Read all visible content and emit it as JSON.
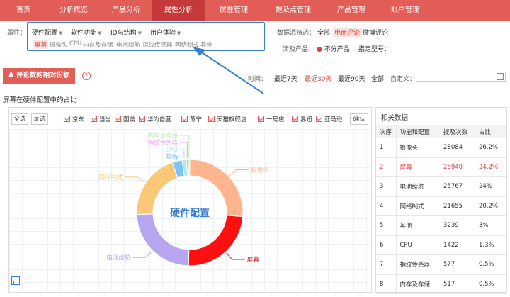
{
  "nav": {
    "items": [
      "首页",
      "分析概览",
      "产品分析",
      "属性分析",
      "属性管理",
      "提及点管理",
      "产品管理",
      "账户管理"
    ],
    "active": 3
  },
  "filter": {
    "attr_label": "属性：",
    "dropdowns": [
      "硬件配置",
      "软件功能",
      "ID与结构",
      "用户体验"
    ],
    "chips": [
      "屏幕",
      "摄像头",
      "CPU",
      "内存及存储",
      "电池续航",
      "指纹传感器",
      "网络制式",
      "其他"
    ],
    "selected_chip": 0,
    "source_label": "数据源筛选：",
    "sources": [
      "全部",
      "电商评论",
      "微博评论"
    ],
    "selected_source": 1,
    "product_label": "涉及产品：",
    "product_radio": "不分产品",
    "model_label": "指定型号："
  },
  "section": {
    "tab_label": "A 评论数的相对份额",
    "help": "?",
    "time_label": "时间：",
    "time_options": [
      "最近7天",
      "最近30天",
      "最近90天",
      "全部"
    ],
    "selected_time": 1,
    "custom_label": "自定义：",
    "chart_title": "屏幕在硬件配置中的占比"
  },
  "controls": {
    "select_all": "全选",
    "invert": "反选",
    "stores": [
      "京东",
      "当当",
      "国美",
      "华为自营",
      "苏宁",
      "天猫旗舰店",
      "一号店",
      "易迅",
      "亚马逊"
    ],
    "confirm": "确认"
  },
  "chart_data": {
    "type": "pie",
    "title": "",
    "center_label": "硬件配置",
    "categories": [
      "摄像头",
      "屏幕",
      "电池续航",
      "网络制式",
      "其他",
      "CPU",
      "指纹传感器",
      "内存及存储"
    ],
    "values": [
      28084,
      25940,
      25767,
      21655,
      3239,
      1422,
      577,
      517
    ],
    "colors": [
      "#fdb58f",
      "#ff0f0f",
      "#b8a5f0",
      "#fbc878",
      "#7ec4f7",
      "#a7ecf0",
      "#e3a8f2",
      "#bdf0ae"
    ],
    "highlight": "屏幕"
  },
  "table": {
    "title": "相关数据",
    "headers": [
      "次序",
      "功能和配置",
      "提及次数",
      "占比"
    ],
    "rows": [
      [
        "1",
        "摄像头",
        "28084",
        "26.2%"
      ],
      [
        "2",
        "屏幕",
        "25940",
        "24.2%"
      ],
      [
        "3",
        "电池续航",
        "25767",
        "24%"
      ],
      [
        "4",
        "网络制式",
        "21655",
        "20.2%"
      ],
      [
        "5",
        "其他",
        "3239",
        "3%"
      ],
      [
        "6",
        "CPU",
        "1422",
        "1.3%"
      ],
      [
        "7",
        "指纹传感器",
        "577",
        "0.5%"
      ],
      [
        "8",
        "内存及存储",
        "517",
        "0.5%"
      ]
    ],
    "highlight_row": 1
  }
}
